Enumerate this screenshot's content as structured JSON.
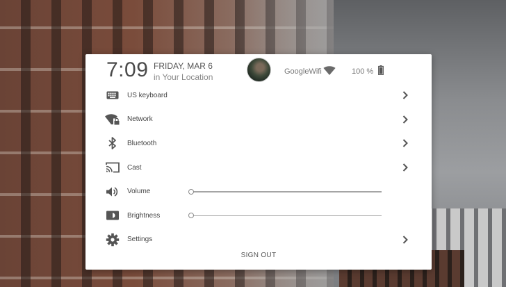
{
  "header": {
    "time": "7:09",
    "date": "FRIDAY, MAR 6",
    "location": "in Your Location",
    "network_name": "GoogleWifi",
    "battery": "100 %"
  },
  "menu": {
    "keyboard": "US keyboard",
    "network": "Network",
    "bluetooth": "Bluetooth",
    "cast": "Cast",
    "volume": "Volume",
    "brightness": "Brightness",
    "settings": "Settings"
  },
  "sliders": {
    "volume_level": 0,
    "brightness_level": 0
  },
  "footer": {
    "sign_out": "SIGN OUT"
  },
  "icons": {
    "keyboard": "keyboard-icon",
    "network": "wifi-lock-icon",
    "bluetooth": "bluetooth-icon",
    "cast": "cast-icon",
    "volume": "volume-icon",
    "brightness": "brightness-icon",
    "settings": "gear-icon",
    "chevron": "chevron-right-icon"
  },
  "colors": {
    "icon": "#555555",
    "panel": "#ffffff"
  }
}
